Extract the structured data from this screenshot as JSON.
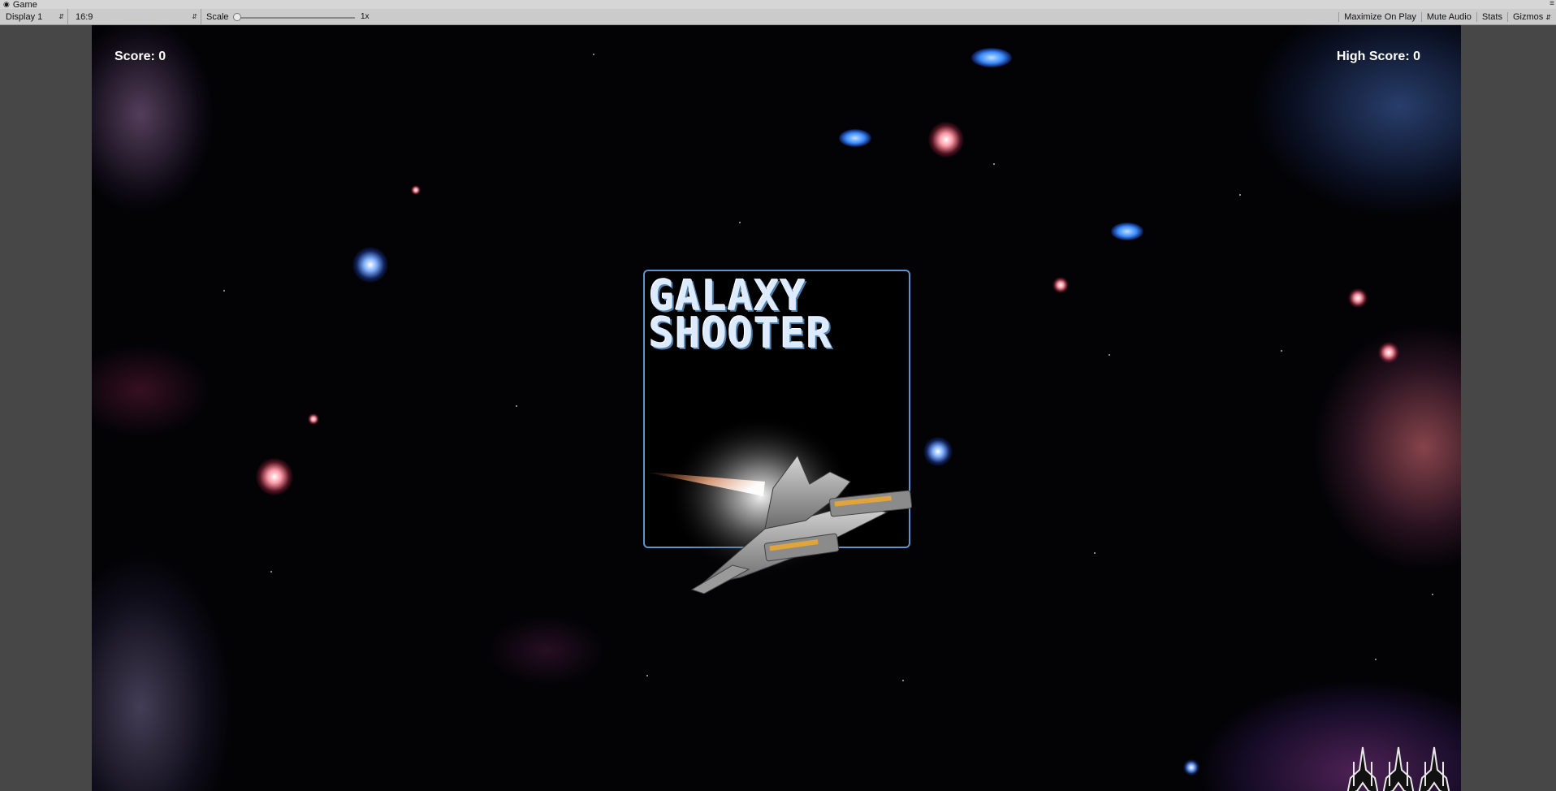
{
  "window": {
    "tab_title": "Game",
    "tab_icon": "unity-icon"
  },
  "toolbar": {
    "display_value": "Display 1",
    "aspect_value": "16:9",
    "scale_label": "Scale",
    "scale_value": "1x",
    "scale_fraction": 0.0,
    "maximize_label": "Maximize On Play",
    "mute_label": "Mute Audio",
    "stats_label": "Stats",
    "gizmos_label": "Gizmos"
  },
  "game": {
    "score_text": "Score: 0",
    "high_score_text": "High Score: 0",
    "title_text": "GALAXY\nSHOOTER",
    "lives_icon": "ship-icon",
    "lives_count": 3,
    "colors": {
      "panel_border": "#5e93cf",
      "title": "#dcebff",
      "background": "#030306"
    }
  }
}
